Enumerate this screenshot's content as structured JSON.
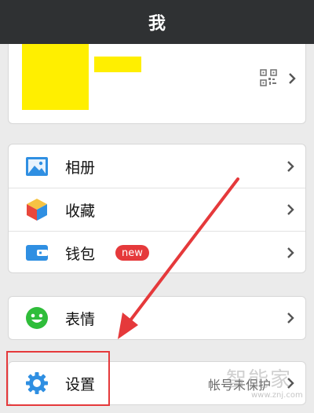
{
  "header": {
    "title": "我"
  },
  "profile": {
    "qr_icon": "qr-code-icon"
  },
  "menu": {
    "album": {
      "label": "相册",
      "icon": "photo-album-icon"
    },
    "favorites": {
      "label": "收藏",
      "icon": "favorites-cube-icon"
    },
    "wallet": {
      "label": "钱包",
      "badge": "new",
      "icon": "wallet-icon"
    },
    "stickers": {
      "label": "表情",
      "icon": "smiley-icon"
    },
    "settings": {
      "label": "设置",
      "status": "帐号未保护",
      "icon": "gear-icon"
    }
  },
  "watermark": {
    "text": "智能家",
    "url": "www.znj.com"
  },
  "colors": {
    "header_bg": "#2f3133",
    "highlight": "#e5393b",
    "arrow": "#e5393b",
    "badge": "#e5393b",
    "redaction": "#ffef00"
  }
}
